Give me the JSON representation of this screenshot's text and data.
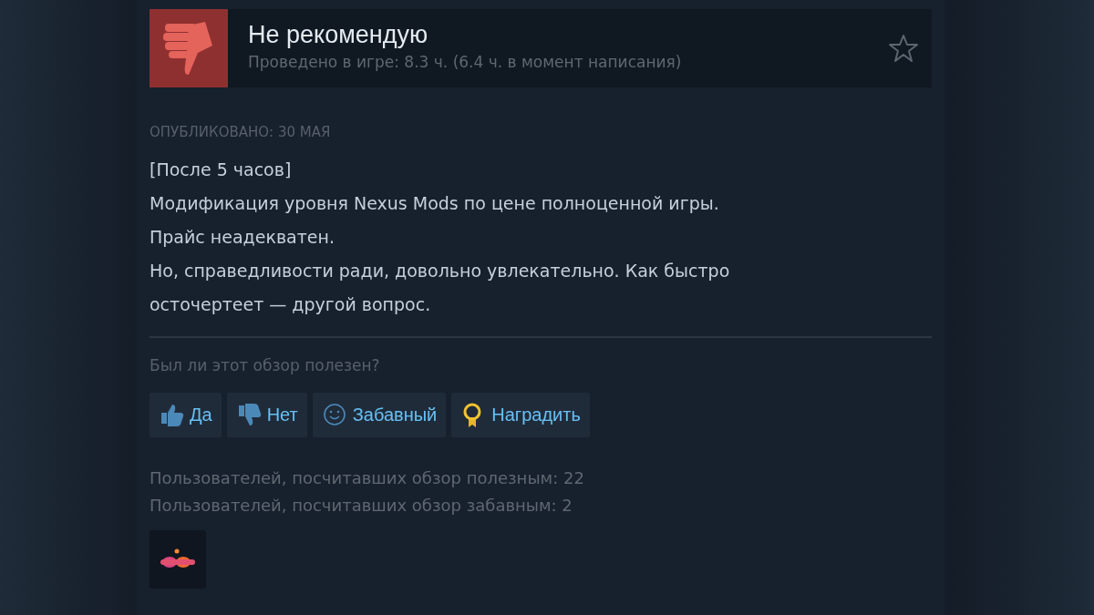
{
  "review": {
    "verdict": "Не рекомендую",
    "playtime": "Проведено в игре: 8.3 ч. (6.4 ч. в момент написания)",
    "posted": "ОПУБЛИКОВАНО: 30 МАЯ",
    "lines": [
      "[После 5 часов]",
      "Модификация уровня Nexus Mods по цене полноценной игры.",
      "Прайс неадекватен.",
      "Но, справедливости ради, довольно увлекательно. Как быстро",
      "осточертеет — другой вопрос."
    ]
  },
  "feedback": {
    "question": "Был ли этот обзор полезен?",
    "buttons": [
      {
        "kind": "yes",
        "label": "Да"
      },
      {
        "kind": "no",
        "label": "Нет"
      },
      {
        "kind": "funny",
        "label": "Забавный"
      },
      {
        "kind": "award",
        "label": "Наградить"
      }
    ],
    "stats": [
      "Пользователей, посчитавших обзор полезным: 22",
      "Пользователей, посчитавших обзор забавным: 2"
    ]
  }
}
